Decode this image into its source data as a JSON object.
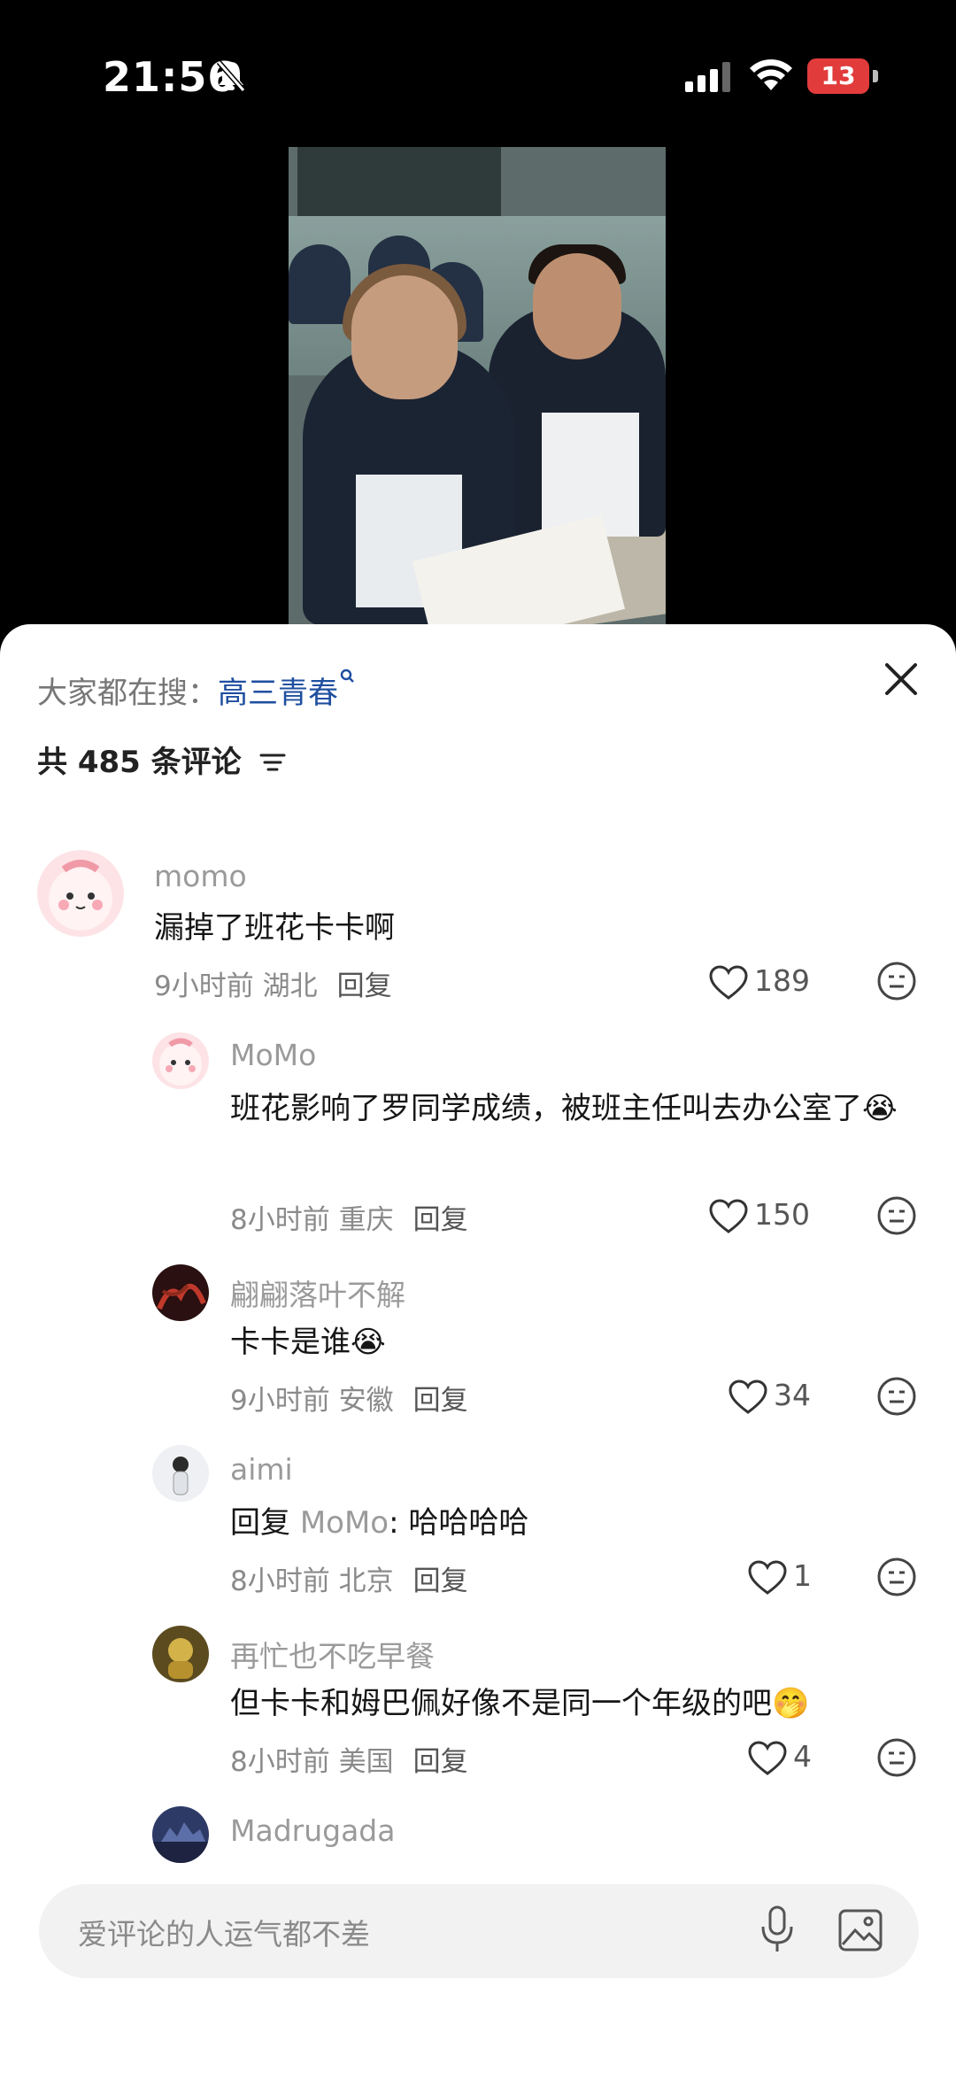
{
  "status_bar": {
    "time": "21:56",
    "battery": "13"
  },
  "search": {
    "prefix": "大家都在搜：",
    "keyword": "高三青春"
  },
  "comment_count": "共 485 条评论",
  "comments": [
    {
      "user": "momo",
      "text": "漏掉了班花卡卡啊",
      "time": "9小时前",
      "location": "湖北",
      "reply": "回复",
      "likes": "189"
    },
    {
      "user": "MoMo",
      "text": "班花影响了罗同学成绩，被班主任叫去办公室了",
      "emoji": "😭",
      "time": "8小时前",
      "location": "重庆",
      "reply": "回复",
      "likes": "150"
    },
    {
      "user": "翩翩落叶不解",
      "text": "卡卡是谁",
      "emoji": "😭",
      "time": "9小时前",
      "location": "安徽",
      "reply": "回复",
      "likes": "34"
    },
    {
      "user": "aimi",
      "reply_prefix": "回复 ",
      "reply_to": "MoMo",
      "text": ": 哈哈哈哈",
      "time": "8小时前",
      "location": "北京",
      "reply": "回复",
      "likes": "1"
    },
    {
      "user": "再忙也不吃早餐",
      "text": "但卡卡和姆巴佩好像不是同一个年级的吧",
      "emoji": "🤭",
      "time": "8小时前",
      "location": "美国",
      "reply": "回复",
      "likes": "4"
    },
    {
      "user": "Madrugada"
    }
  ],
  "input": {
    "placeholder": "爱评论的人运气都不差"
  },
  "icons": {
    "close": "close-icon",
    "filter": "filter-icon",
    "heart": "heart-icon",
    "more": "more-face-icon",
    "mic": "mic-icon",
    "image": "image-icon"
  }
}
